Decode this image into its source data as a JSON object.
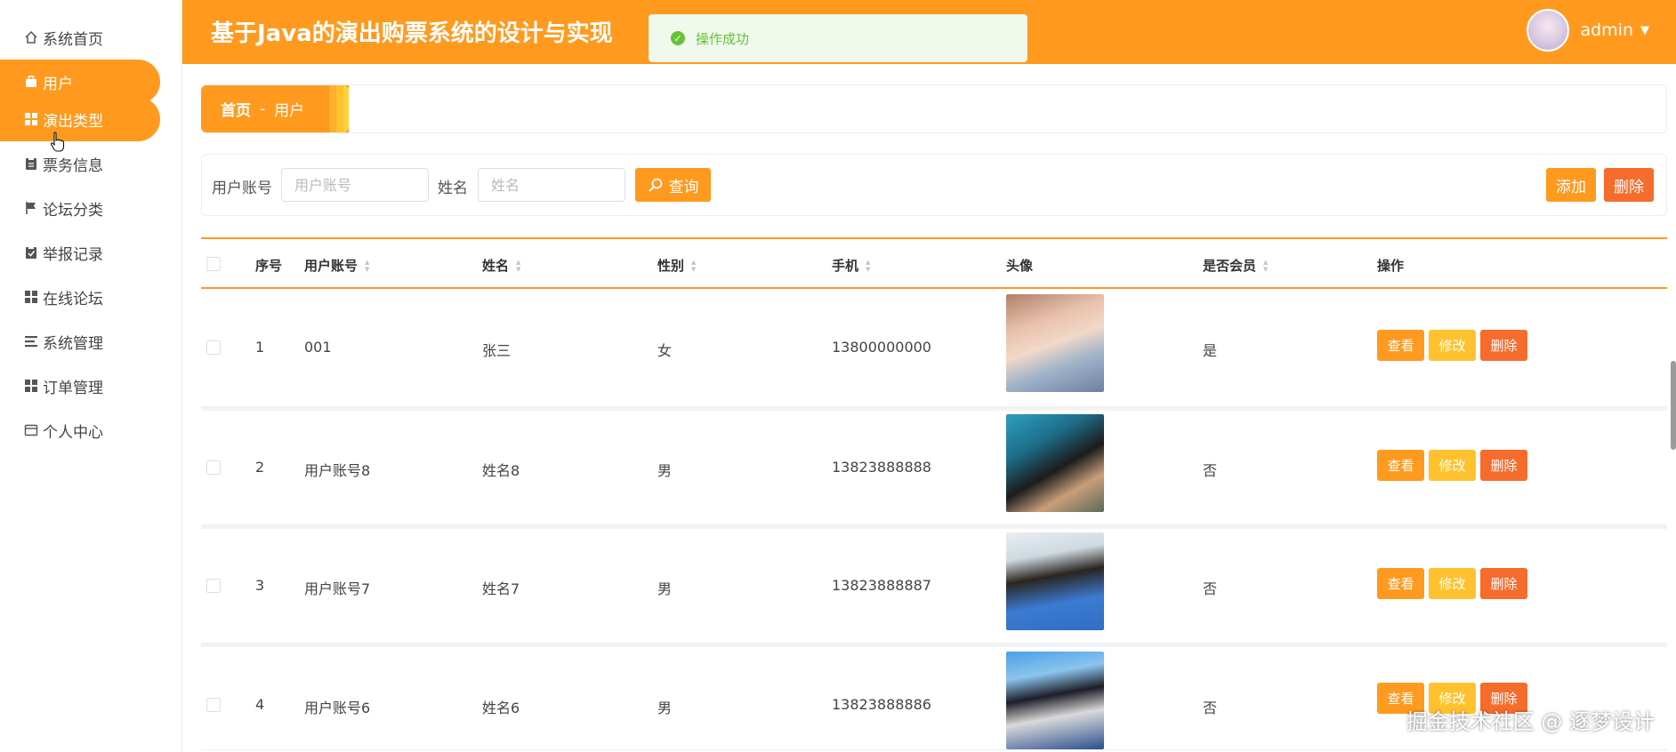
{
  "header": {
    "title": "基于Java的演出购票系统的设计与实现",
    "toast": "操作成功",
    "username": "admin"
  },
  "sidebar": {
    "items": [
      {
        "label": "系统首页",
        "icon": "home-icon"
      },
      {
        "label": "用户",
        "icon": "bag-icon"
      },
      {
        "label": "演出类型",
        "icon": "grid-icon"
      },
      {
        "label": "票务信息",
        "icon": "clipboard-icon"
      },
      {
        "label": "论坛分类",
        "icon": "flag-icon"
      },
      {
        "label": "举报记录",
        "icon": "clipboard-check-icon"
      },
      {
        "label": "在线论坛",
        "icon": "grid-icon"
      },
      {
        "label": "系统管理",
        "icon": "list-icon"
      },
      {
        "label": "订单管理",
        "icon": "grid-icon"
      },
      {
        "label": "个人中心",
        "icon": "card-icon"
      }
    ]
  },
  "breadcrumb": {
    "home": "首页",
    "sep": "-",
    "current": "用户"
  },
  "search": {
    "account_label": "用户账号",
    "account_placeholder": "用户账号",
    "name_label": "姓名",
    "name_placeholder": "姓名",
    "query_label": "查询",
    "add_label": "添加",
    "delete_label": "删除"
  },
  "table": {
    "headers": [
      "序号",
      "用户账号",
      "姓名",
      "性别",
      "手机",
      "头像",
      "是否会员",
      "操作"
    ],
    "action_labels": {
      "view": "查看",
      "edit": "修改",
      "delete": "删除"
    },
    "rows": [
      {
        "index": "1",
        "account": "001",
        "name": "张三",
        "gender": "女",
        "phone": "13800000000",
        "member": "是"
      },
      {
        "index": "2",
        "account": "用户账号8",
        "name": "姓名8",
        "gender": "男",
        "phone": "13823888888",
        "member": "否"
      },
      {
        "index": "3",
        "account": "用户账号7",
        "name": "姓名7",
        "gender": "男",
        "phone": "13823888887",
        "member": "否"
      },
      {
        "index": "4",
        "account": "用户账号6",
        "name": "姓名6",
        "gender": "男",
        "phone": "13823888886",
        "member": "否"
      }
    ]
  },
  "watermark": "掘金技术社区 @ 逐梦设计",
  "colors": {
    "accent": "#ff9a1f",
    "edit": "#ffc22e",
    "danger": "#f56c2c",
    "success": "#67c23a"
  }
}
